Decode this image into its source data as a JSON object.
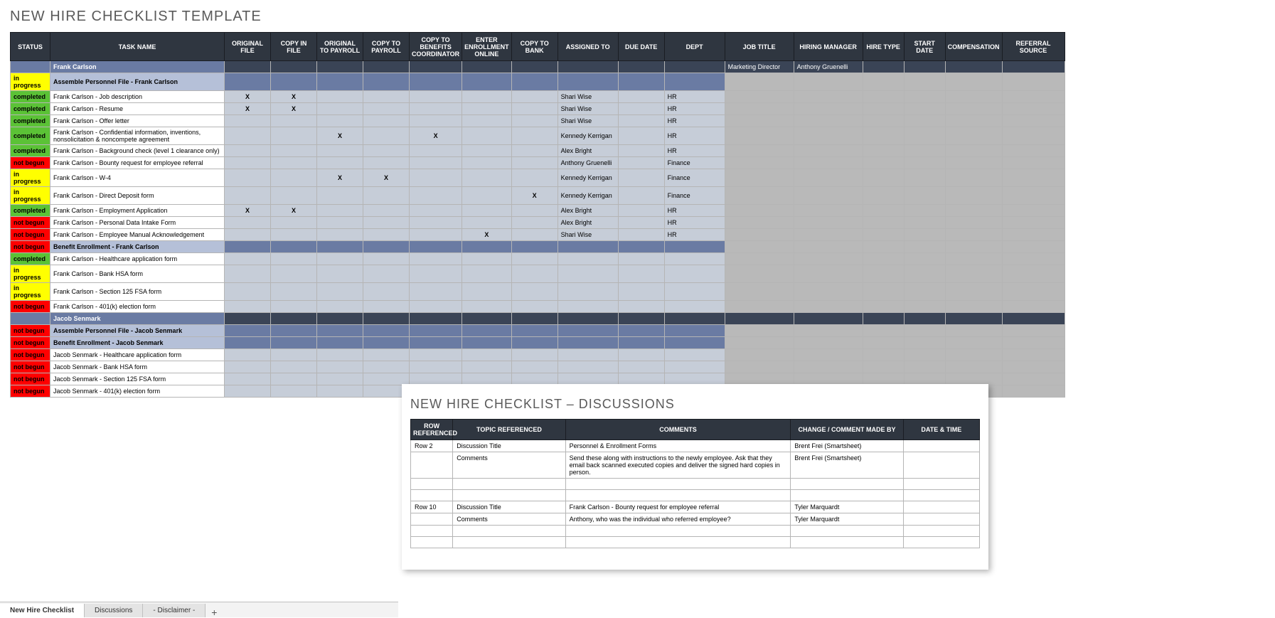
{
  "title": "NEW HIRE CHECKLIST TEMPLATE",
  "headers": [
    "STATUS",
    "TASK NAME",
    "ORIGINAL FILE",
    "COPY IN FILE",
    "ORIGINAL TO PAYROLL",
    "COPY TO PAYROLL",
    "COPY TO BENEFITS COORDINATOR",
    "ENTER ENROLLMENT ONLINE",
    "COPY TO BANK",
    "ASSIGNED TO",
    "DUE DATE",
    "DEPT",
    "JOB TITLE",
    "HIRING MANAGER",
    "HIRE TYPE",
    "START DATE",
    "COMPENSATION",
    "REFERRAL SOURCE"
  ],
  "rows": [
    {
      "type": "person",
      "task": "Frank Carlson",
      "job": "Marketing Director",
      "mgr": "Anthony Gruenelli"
    },
    {
      "type": "section",
      "status": "in progress",
      "stc": "progress",
      "task": "Assemble Personnel File - Frank Carlson"
    },
    {
      "type": "task",
      "status": "completed",
      "stc": "completed",
      "task": "Frank Carlson - Job description",
      "c": {
        "2": "X",
        "3": "X"
      },
      "assigned": "Shari Wise",
      "dept": "HR"
    },
    {
      "type": "task",
      "status": "completed",
      "stc": "completed",
      "task": "Frank Carlson - Resume",
      "c": {
        "2": "X",
        "3": "X"
      },
      "assigned": "Shari Wise",
      "dept": "HR"
    },
    {
      "type": "task",
      "status": "completed",
      "stc": "completed",
      "task": "Frank Carlson - Offer letter",
      "assigned": "Shari Wise",
      "dept": "HR"
    },
    {
      "type": "task",
      "status": "completed",
      "stc": "completed",
      "task": "Frank Carlson - Confidential information, inventions, nonsolicitation & noncompete agreement",
      "c": {
        "4": "X",
        "6": "X"
      },
      "assigned": "Kennedy Kerrigan",
      "dept": "HR"
    },
    {
      "type": "task",
      "status": "completed",
      "stc": "completed",
      "task": "Frank Carlson - Background check (level 1 clearance only)",
      "assigned": "Alex Bright",
      "dept": "HR"
    },
    {
      "type": "task",
      "status": "not begun",
      "stc": "notbegun",
      "task": "Frank Carlson - Bounty request for employee referral",
      "assigned": "Anthony Gruenelli",
      "dept": "Finance"
    },
    {
      "type": "task",
      "status": "in progress",
      "stc": "progress",
      "task": "Frank Carlson - W-4",
      "c": {
        "4": "X",
        "5": "X"
      },
      "assigned": "Kennedy Kerrigan",
      "dept": "Finance"
    },
    {
      "type": "task",
      "status": "in progress",
      "stc": "progress",
      "task": "Frank Carlson - Direct Deposit form",
      "c": {
        "8": "X"
      },
      "assigned": "Kennedy Kerrigan",
      "dept": "Finance"
    },
    {
      "type": "task",
      "status": "completed",
      "stc": "completed",
      "task": "Frank Carlson - Employment Application",
      "c": {
        "2": "X",
        "3": "X"
      },
      "assigned": "Alex Bright",
      "dept": "HR"
    },
    {
      "type": "task",
      "status": "not begun",
      "stc": "notbegun",
      "task": "Frank Carlson - Personal Data Intake Form",
      "assigned": "Alex Bright",
      "dept": "HR"
    },
    {
      "type": "task",
      "status": "not begun",
      "stc": "notbegun",
      "task": "Frank Carlson - Employee Manual Acknowledgement",
      "c": {
        "7": "X"
      },
      "assigned": "Shari Wise",
      "dept": "HR"
    },
    {
      "type": "section",
      "status": "not begun",
      "stc": "notbegun",
      "task": "Benefit Enrollment - Frank Carlson"
    },
    {
      "type": "task",
      "status": "completed",
      "stc": "completed",
      "task": "Frank Carlson - Healthcare application form"
    },
    {
      "type": "task",
      "status": "in progress",
      "stc": "progress",
      "task": "Frank Carlson - Bank HSA form"
    },
    {
      "type": "task",
      "status": "in progress",
      "stc": "progress",
      "task": "Frank Carlson - Section 125 FSA form"
    },
    {
      "type": "task",
      "status": "not begun",
      "stc": "notbegun",
      "task": "Frank Carlson - 401(k) election form"
    },
    {
      "type": "person",
      "task": "Jacob Senmark"
    },
    {
      "type": "section",
      "status": "not begun",
      "stc": "notbegun",
      "task": "Assemble Personnel File - Jacob Senmark"
    },
    {
      "type": "section",
      "status": "not begun",
      "stc": "notbegun",
      "task": "Benefit Enrollment - Jacob Senmark"
    },
    {
      "type": "task",
      "status": "not begun",
      "stc": "notbegun",
      "task": "Jacob Senmark - Healthcare application form"
    },
    {
      "type": "task",
      "status": "not begun",
      "stc": "notbegun",
      "task": "Jacob Senmark - Bank HSA form"
    },
    {
      "type": "task",
      "status": "not begun",
      "stc": "notbegun",
      "task": "Jacob Senmark - Section 125 FSA form"
    },
    {
      "type": "task",
      "status": "not begun",
      "stc": "notbegun",
      "task": "Jacob Senmark - 401(k) election form"
    }
  ],
  "discussions": {
    "title": "NEW HIRE CHECKLIST  –  DISCUSSIONS",
    "headers": [
      "ROW REFERENCED",
      "TOPIC REFERENCED",
      "COMMENTS",
      "CHANGE / COMMENT MADE BY",
      "DATE & TIME"
    ],
    "rows": [
      {
        "row": "Row 2",
        "topic": "Discussion Title",
        "comments": "Personnel & Enrollment Forms",
        "made": "Brent Frei (Smartsheet)",
        "date": ""
      },
      {
        "row": "",
        "topic": "Comments",
        "comments": "Send these along with instructions to the newly employee.  Ask that they email back scanned executed copies and deliver the signed hard copies in person.",
        "made": "Brent Frei (Smartsheet)",
        "date": ""
      },
      {
        "row": "",
        "topic": "",
        "comments": "",
        "made": "",
        "date": ""
      },
      {
        "row": "",
        "topic": "",
        "comments": "",
        "made": "",
        "date": ""
      },
      {
        "row": "Row 10",
        "topic": "Discussion Title",
        "comments": "Frank Carlson - Bounty request for employee referral",
        "made": "Tyler Marquardt",
        "date": ""
      },
      {
        "row": "",
        "topic": "Comments",
        "comments": "Anthony, who was the individual who referred employee?",
        "made": "Tyler Marquardt",
        "date": ""
      },
      {
        "row": "",
        "topic": "",
        "comments": "",
        "made": "",
        "date": ""
      },
      {
        "row": "",
        "topic": "",
        "comments": "",
        "made": "",
        "date": ""
      }
    ]
  },
  "tabs": {
    "active": "New Hire Checklist",
    "items": [
      "New Hire Checklist",
      "Discussions",
      "- Disclaimer -"
    ],
    "add": "+"
  }
}
